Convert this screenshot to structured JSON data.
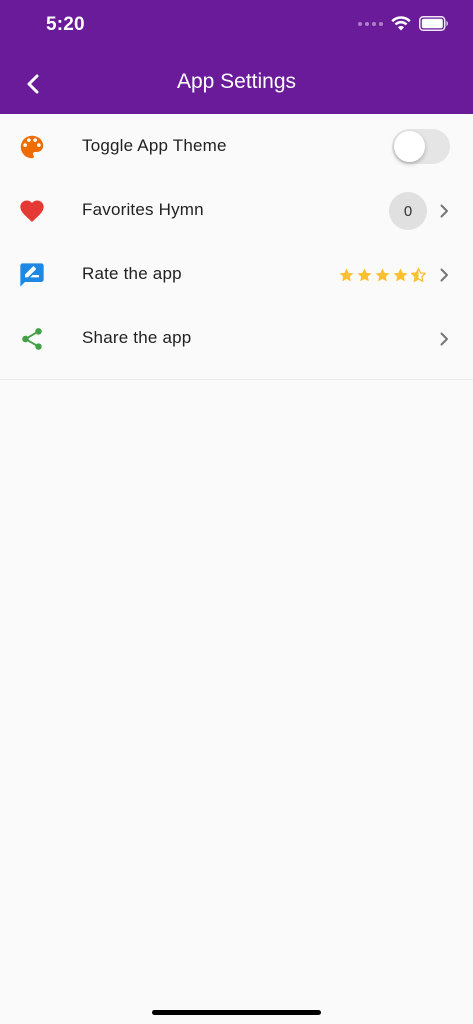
{
  "status_bar": {
    "time": "5:20"
  },
  "app_bar": {
    "title": "App Settings",
    "back_icon": "chevron-left-icon"
  },
  "settings": {
    "theme": {
      "label": "Toggle App Theme",
      "icon": "palette-icon",
      "icon_color": "#ef6c00",
      "enabled": false
    },
    "favorites": {
      "label": "Favorites Hymn",
      "icon": "heart-icon",
      "icon_color": "#e53935",
      "count": "0"
    },
    "rate": {
      "label": "Rate the app",
      "icon": "rate-review-icon",
      "icon_color": "#1e88e5",
      "rating": 4.5,
      "rating_max": 5,
      "star_color": "#fbc02d"
    },
    "share": {
      "label": "Share the app",
      "icon": "share-icon",
      "icon_color": "#43a047"
    }
  },
  "colors": {
    "primary": "#6a1b9a",
    "background": "#fafafa"
  }
}
